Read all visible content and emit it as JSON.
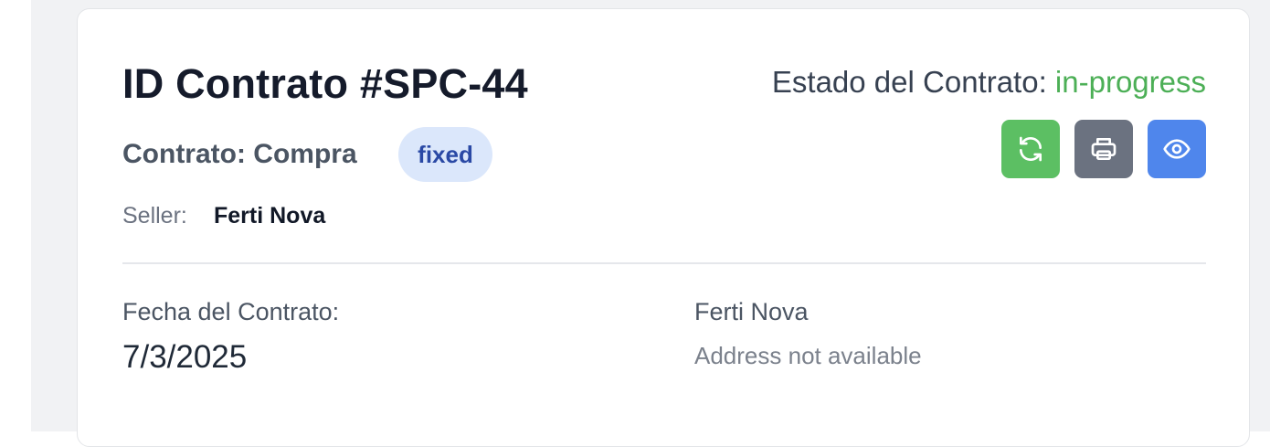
{
  "contract": {
    "title": "ID Contrato #SPC-44",
    "type_label": "Contrato: Compra",
    "price_badge": "fixed",
    "seller_label": "Seller:",
    "seller_name": "Ferti Nova"
  },
  "status": {
    "label": "Estado del Contrato:",
    "value": "in-progress",
    "value_color": "#4caf56"
  },
  "actions": [
    {
      "name": "refresh",
      "icon": "refresh-icon",
      "color": "#5cbf63"
    },
    {
      "name": "print",
      "icon": "printer-icon",
      "color": "#6b7280"
    },
    {
      "name": "view",
      "icon": "eye-icon",
      "color": "#4f86ec"
    }
  ],
  "details": {
    "date_label": "Fecha del Contrato:",
    "date_value": "7/3/2025",
    "party_name": "Ferti Nova",
    "party_address": "Address not available"
  }
}
